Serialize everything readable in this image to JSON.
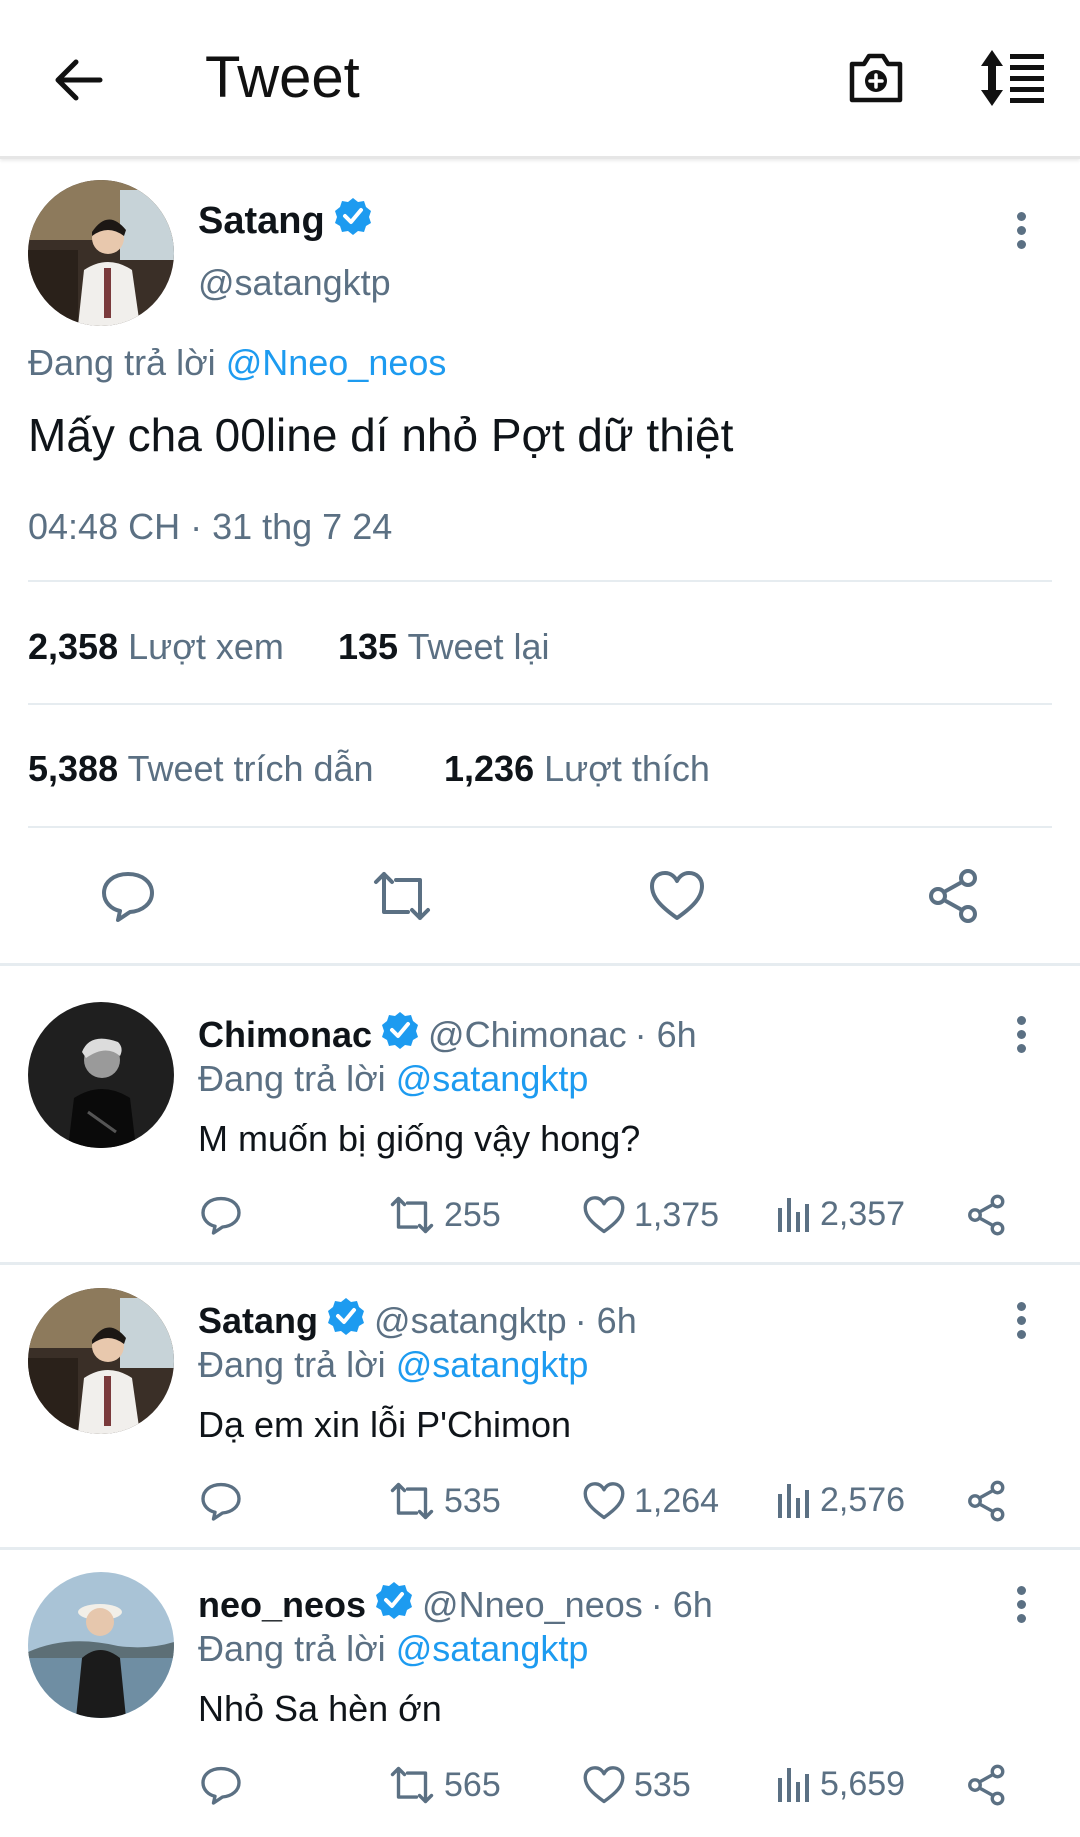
{
  "header": {
    "title": "Tweet"
  },
  "tweet": {
    "author_name": "Satang",
    "author_handle": "@satangktp",
    "replying_prefix": "Đang trả lời",
    "replying_to": "@Nneo_neos",
    "text": "Mấy cha 00line dí nhỏ Pợt dữ thiệt",
    "timestamp": "04:48 CH · 31 thg 7 24",
    "views_count": "2,358",
    "views_label": "Lượt xem",
    "retweets_count": "135",
    "retweets_label": "Tweet lại",
    "quotes_count": "5,388",
    "quotes_label": "Tweet trích dẫn",
    "likes_count": "1,236",
    "likes_label": "Lượt thích"
  },
  "replies": [
    {
      "name": "Chimonac",
      "handle": "@Chimonac",
      "time": "· 6h",
      "replying_prefix": "Đang trả lời",
      "replying_to": "@satangktp",
      "text": "M muốn bị giống vậy hong?",
      "retweets": "255",
      "likes": "1,375",
      "views": "2,357"
    },
    {
      "name": "Satang",
      "handle": "@satangktp",
      "time": "· 6h",
      "replying_prefix": "Đang trả lời",
      "replying_to": "@satangktp",
      "text": "Dạ em xin lỗi P'Chimon",
      "retweets": "535",
      "likes": "1,264",
      "views": "2,576"
    },
    {
      "name": "neo_neos",
      "handle": "@Nneo_neos",
      "time": "· 6h",
      "replying_prefix": "Đang trả lời",
      "replying_to": "@satangktp",
      "text": "Nhỏ Sa hèn ớn",
      "retweets": "565",
      "likes": "535",
      "views": "5,659"
    }
  ],
  "colors": {
    "accent": "#1d9bf0",
    "secondary_text": "#5b7083",
    "divider": "#e6ecf0"
  }
}
